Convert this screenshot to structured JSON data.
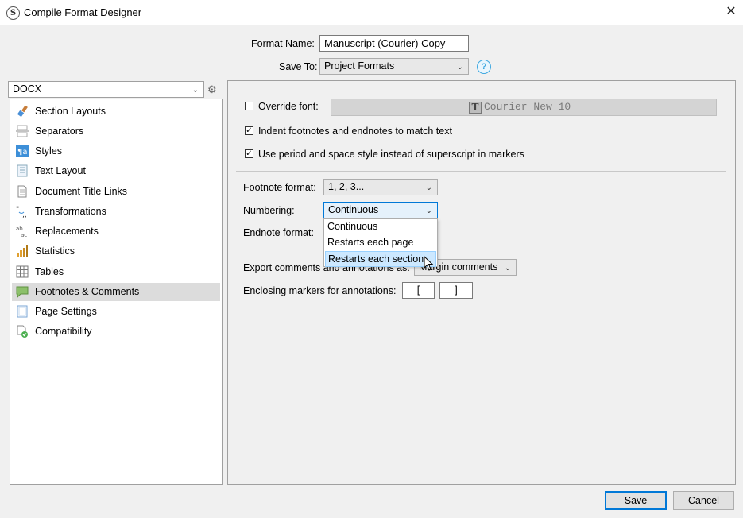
{
  "window": {
    "title": "Compile Format Designer"
  },
  "header": {
    "format_name_label": "Format Name:",
    "format_name_value": "Manuscript (Courier) Copy",
    "save_to_label": "Save To:",
    "save_to_value": "Project Formats",
    "help": "?"
  },
  "left": {
    "output_type": "DOCX",
    "items": [
      {
        "label": "Section Layouts",
        "icon": "brush-icon"
      },
      {
        "label": "Separators",
        "icon": "separator-icon"
      },
      {
        "label": "Styles",
        "icon": "styles-icon"
      },
      {
        "label": "Text Layout",
        "icon": "text-layout-icon"
      },
      {
        "label": "Document Title Links",
        "icon": "document-icon"
      },
      {
        "label": "Transformations",
        "icon": "quotes-icon"
      },
      {
        "label": "Replacements",
        "icon": "replace-icon"
      },
      {
        "label": "Statistics",
        "icon": "bar-chart-icon"
      },
      {
        "label": "Tables",
        "icon": "table-icon"
      },
      {
        "label": "Footnotes & Comments",
        "icon": "comment-icon"
      },
      {
        "label": "Page Settings",
        "icon": "page-icon"
      },
      {
        "label": "Compatibility",
        "icon": "compat-icon"
      }
    ],
    "selected": "Footnotes & Comments"
  },
  "main": {
    "override_font_label": "Override font:",
    "override_font_checked": false,
    "font_value": "Courier New 10",
    "indent_label": "Indent footnotes and endnotes to match text",
    "indent_checked": true,
    "period_label": "Use period and space style instead of superscript in markers",
    "period_checked": true,
    "footnote_format_label": "Footnote format:",
    "footnote_format_value": "1, 2, 3...",
    "numbering_label": "Numbering:",
    "numbering_value": "Continuous",
    "numbering_options": [
      "Continuous",
      "Restarts each page",
      "Restarts each section"
    ],
    "numbering_highlighted": "Restarts each section",
    "endnote_format_label": "Endnote format:",
    "export_label": "Export comments and annotations as:",
    "export_value": "Margin comments",
    "enclosing_label": "Enclosing markers for annotations:",
    "marker_open": "[",
    "marker_close": "]"
  },
  "footer": {
    "save": "Save",
    "cancel": "Cancel"
  }
}
